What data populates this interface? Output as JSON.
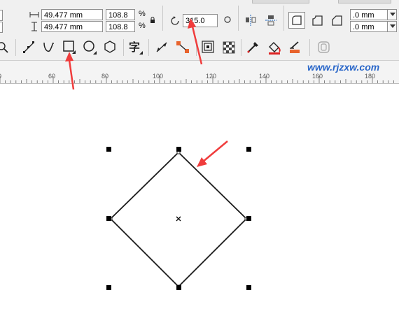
{
  "size": {
    "width_value": "49.477 mm",
    "height_value": "49.477 mm",
    "scale_x": "108.8",
    "scale_y": "108.8",
    "percent_x": "%",
    "percent_y": "%"
  },
  "rotation": {
    "angle": "315.0"
  },
  "corner": {
    "radius_top": ".0 mm",
    "radius_bottom": ".0 mm"
  },
  "ruler": {
    "ticks": [
      "60",
      "80",
      "100",
      "120",
      "140",
      "160",
      "180"
    ]
  },
  "watermark": {
    "text": "www.rjzxw.com"
  },
  "colors": {
    "arrow": "#f03c3c",
    "watermark": "#2a67c9"
  }
}
